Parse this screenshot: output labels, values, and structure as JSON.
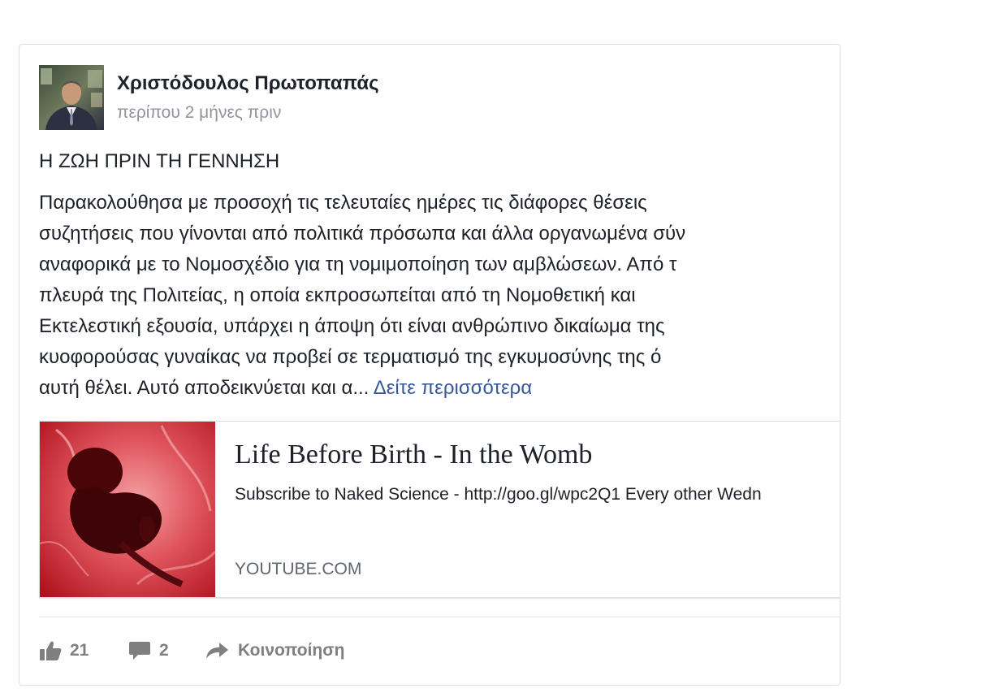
{
  "post": {
    "author": "Χριστόδουλος Πρωτοπαπάς",
    "timestamp": "περίπου 2 μήνες πριν",
    "headline": "Η ΖΩΗ ΠΡΙΝ ΤΗ ΓΕΝΝΗΣΗ",
    "body_lines": [
      "Παρακολούθησα με προσοχή τις τελευταίες ημέρες τις διάφορες θέσεις",
      "συζητήσεις που γίνονται από πολιτικά πρόσωπα και άλλα οργανωμένα σύν",
      "αναφορικά με το Νομοσχέδιο για τη νομιμοποίηση των αμβλώσεων. Από τ",
      "πλευρά της Πολιτείας, η οποία εκπροσωπείται από τη Νομοθετική και",
      "Εκτελεστική εξουσία, υπάρχει η άποψη ότι είναι ανθρώπινο δικαίωμα της",
      "κυοφορούσας γυναίκας να προβεί σε τερματισμό της εγκυμοσύνης της ό"
    ],
    "body_last_line": "αυτή θέλει. Αυτό αποδεικνύεται και α...",
    "see_more": "Δείτε περισσότερα"
  },
  "link_preview": {
    "title": "Life Before Birth - In the Womb",
    "description": "Subscribe to Naked Science - http://goo.gl/wpc2Q1 Every other Wedn",
    "domain": "YOUTUBE.COM"
  },
  "actions": {
    "likes": "21",
    "comments": "2",
    "share_label": "Κοινοποίηση"
  },
  "icons": {
    "like": "thumbs-up-icon",
    "comment": "comment-bubble-icon",
    "share": "share-arrow-icon"
  },
  "colors": {
    "link": "#365899",
    "muted": "#90949c",
    "action": "#7f7f7f",
    "text": "#1d2129"
  }
}
